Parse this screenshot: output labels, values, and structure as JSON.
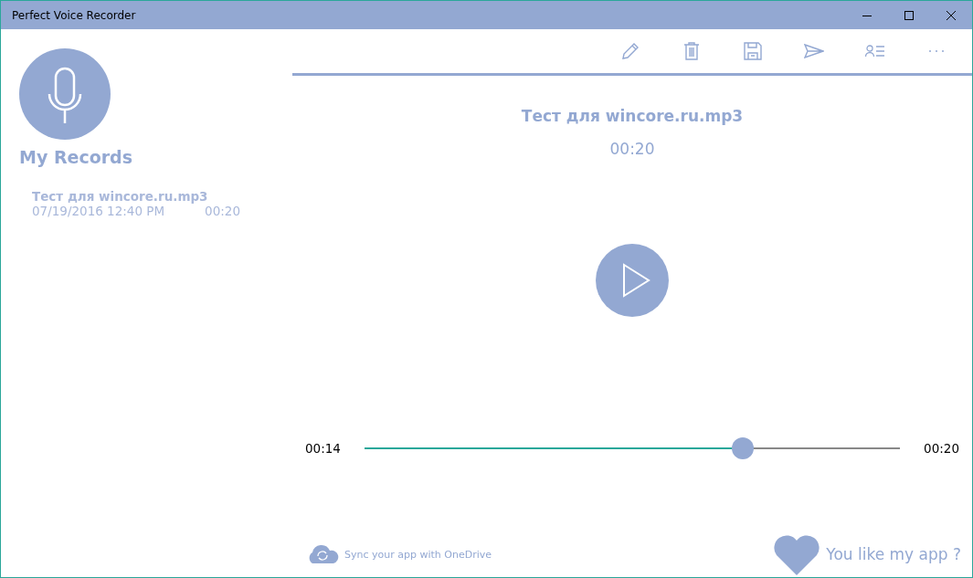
{
  "window": {
    "title": "Perfect Voice Recorder"
  },
  "sidebar": {
    "heading": "My Records",
    "records": [
      {
        "name": "Тест для wincore.ru.mp3",
        "date": "07/19/2016 12:40 PM",
        "duration": "00:20",
        "selected": false
      }
    ]
  },
  "player": {
    "title": "Тест для wincore.ru.mp3",
    "duration": "00:20",
    "elapsed": "00:14",
    "total": "00:20",
    "position": {
      "level": 0.707
    }
  },
  "footer": {
    "sync": "Sync your app with OneDrive",
    "like": "You like my app ?"
  }
}
